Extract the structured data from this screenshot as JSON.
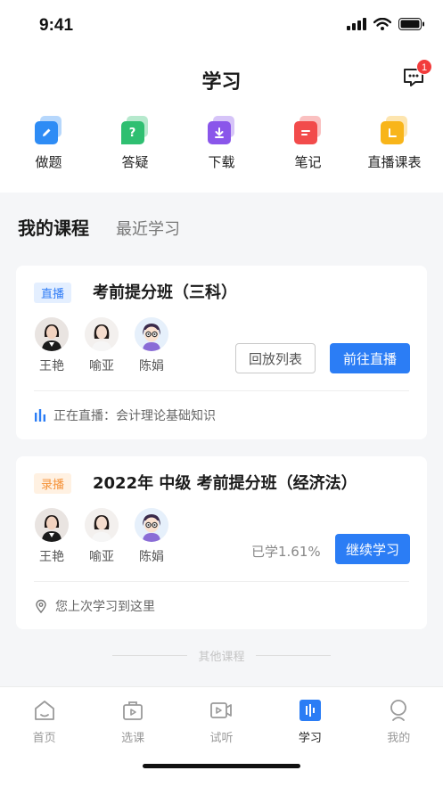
{
  "status": {
    "time": "9:41"
  },
  "header": {
    "title": "学习",
    "message_badge": "1"
  },
  "quick_actions": [
    {
      "label": "做题",
      "icon": "pen-icon",
      "color": "#2e8cf5"
    },
    {
      "label": "答疑",
      "icon": "question-icon",
      "color": "#2fbf71"
    },
    {
      "label": "下载",
      "icon": "download-icon",
      "color": "#8a56ea"
    },
    {
      "label": "笔记",
      "icon": "note-icon",
      "color": "#f24b4b"
    },
    {
      "label": "直播课表",
      "icon": "schedule-icon",
      "color": "#f8b51a"
    }
  ],
  "tabs": {
    "active": "我的课程",
    "inactive": "最近学习"
  },
  "courses": [
    {
      "tag": "直播",
      "title": "考前提分班（三科）",
      "teachers": [
        "王艳",
        "喻亚",
        "陈娟"
      ],
      "secondary_button": "回放列表",
      "primary_button": "前往直播",
      "footer": "正在直播：会计理论基础知识"
    },
    {
      "tag": "录播",
      "title": "2022年 中级 考前提分班（经济法）",
      "teachers": [
        "王艳",
        "喻亚",
        "陈娟"
      ],
      "progress": "已学1.61%",
      "primary_button": "继续学习",
      "footer": "您上次学习到这里"
    }
  ],
  "other_courses_label": "其他课程",
  "tabbar": [
    {
      "label": "首页",
      "icon": "home-icon"
    },
    {
      "label": "选课",
      "icon": "course-bag-icon"
    },
    {
      "label": "试听",
      "icon": "video-icon"
    },
    {
      "label": "学习",
      "icon": "study-icon",
      "active": true
    },
    {
      "label": "我的",
      "icon": "profile-icon"
    }
  ],
  "colors": {
    "accent": "#2b7df5",
    "live_tag": "#2f7cf6",
    "recorded_tag": "#f5933a",
    "badge": "#f23c3c"
  }
}
